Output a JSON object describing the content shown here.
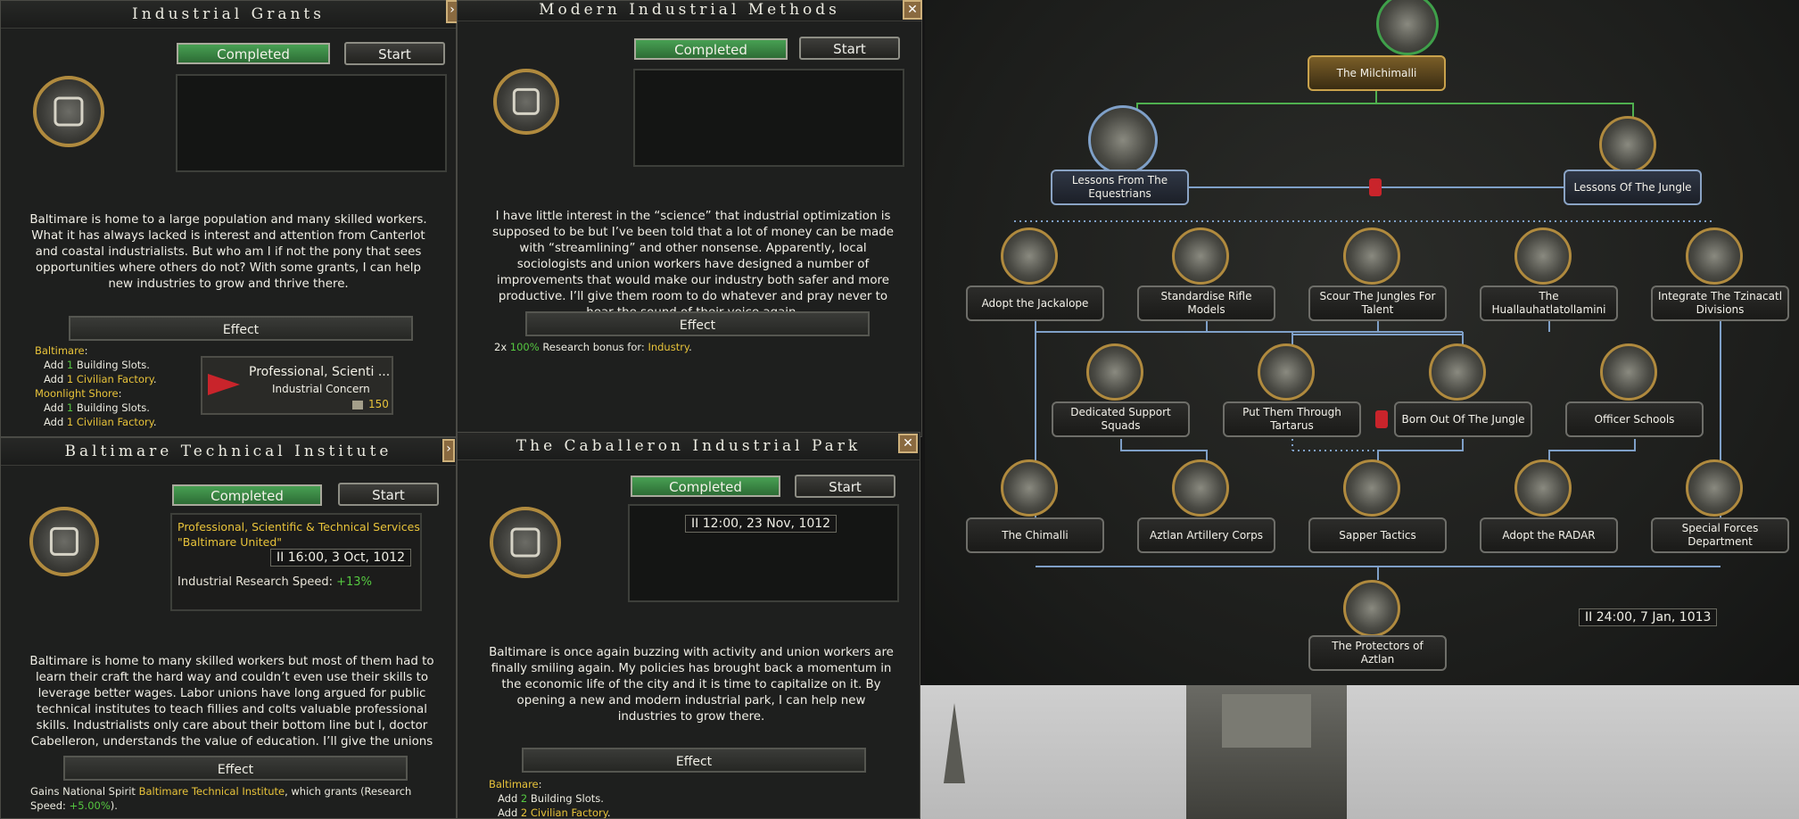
{
  "panels": {
    "industrial_grants": {
      "title": "Industrial Grants",
      "completed": "Completed",
      "start": "Start",
      "description": "Baltimare is home to a large population and many skilled workers. What it has always lacked is interest and attention from Canterlot and coastal industrialists. But who am I if not the pony that sees opportunities where others do not? With some grants, I can help new industries to grow and thrive there.",
      "effect_label": "Effect",
      "effects": {
        "state1": "Baltimare",
        "l1a": "Add ",
        "l1a_n": "1",
        "l1a_t": " Building Slots.",
        "l1b": "Add ",
        "l1b_t": "1 Civilian Factory",
        "l1b_end": ".",
        "state2": "Moonlight Shore",
        "l2a": "Add ",
        "l2a_n": "1",
        "l2a_t": " Building Slots.",
        "l2b": "Add ",
        "l2b_t": "1 Civilian Factory",
        "l2b_end": "."
      },
      "concern": {
        "name": "Professional, Scienti ...",
        "type": "Industrial Concern",
        "cost": "150"
      }
    },
    "modern_methods": {
      "title": "Modern Industrial Methods",
      "completed": "Completed",
      "start": "Start",
      "description": "I have little interest in the “science” that industrial optimization is supposed to be but I’ve been told that a lot of money can be made with “streamlining” and other nonsense. Apparently, local sociologists and union workers have designed a number of improvements that would make our industry both safer and more productive. I’ll give them room to do whatever and pray never to hear the sound of their voice again.",
      "effect_label": "Effect",
      "effect_prefix": "2x ",
      "effect_pct": "100%",
      "effect_mid": " Research bonus for: ",
      "effect_target": "Industry",
      "effect_end": "."
    },
    "technical_institute": {
      "title": "Baltimare Technical Institute",
      "completed": "Completed",
      "start": "Start",
      "info_line1": "Professional, Scientific & Technical Services",
      "info_line2": "\"Baltimare United\"",
      "info_timer": "16:00, 3 Oct, 1012",
      "info_speed_label": "Industrial Research Speed: ",
      "info_speed_value": "+13%",
      "description": "Baltimare is home to many skilled workers but most of them had to learn their craft the hard way and couldn’t even use their skills to leverage better wages. Labor unions have long argued for public technical institutes to teach fillies and colts valuable professional skills. Industrialists only care about their bottom line but I, doctor Cabelleron, understands the value of education. I’ll give the unions",
      "effect_label": "Effect",
      "effect_a": "Gains National Spirit ",
      "effect_spirit": "Baltimare Technical Institute",
      "effect_b": ", which grants (Research Speed: ",
      "effect_pct": "+5.00%",
      "effect_c": ")."
    },
    "industrial_park": {
      "title": "The Caballeron Industrial Park",
      "completed": "Completed",
      "start": "Start",
      "timer": "12:00, 23 Nov, 1012",
      "description": "Baltimare is once again buzzing with activity and union workers are finally smiling again. My policies has brought back a momentum in the economic life of the city and it is time to capitalize on it. By opening a new and modern industrial park, I can help new industries to grow there.",
      "effect_label": "Effect",
      "state": "Baltimare",
      "l1": "Add ",
      "l1_n": "2",
      "l1_t": " Building Slots.",
      "l2": "Add ",
      "l2_t": "2 Civilian Factory",
      "l2_end": "."
    }
  },
  "focus_tree": {
    "timer": "24:00, 7 Jan, 1013",
    "nodes": {
      "milchimalli": "The Milchimalli",
      "equestrians": "Lessons From The Equestrians",
      "jungle": "Lessons Of The Jungle",
      "jackalope": "Adopt the Jackalope",
      "rifle": "Standardise Rifle Models",
      "scour": "Scour The Jungles For Talent",
      "huallau": "The Huallauhatlatollamini",
      "tzinacatl": "Integrate The Tzinacatl Divisions",
      "support": "Dedicated Support Squads",
      "tartarus": "Put Them Through Tartarus",
      "bornjungle": "Born Out Of The Jungle",
      "officer": "Officer Schools",
      "chimalli": "The Chimalli",
      "artillery": "Aztlan Artillery Corps",
      "sapper": "Sapper Tactics",
      "radar": "Adopt the RADAR",
      "special": "Special Forces Department",
      "protectors": "The Protectors of Aztlan"
    }
  },
  "colors": {
    "completed_green": "#3d8a46",
    "highlight_yellow": "#e8c33a",
    "positive_green": "#55c840",
    "line_green": "#4fb04f",
    "line_blue": "#7fa0c8"
  }
}
